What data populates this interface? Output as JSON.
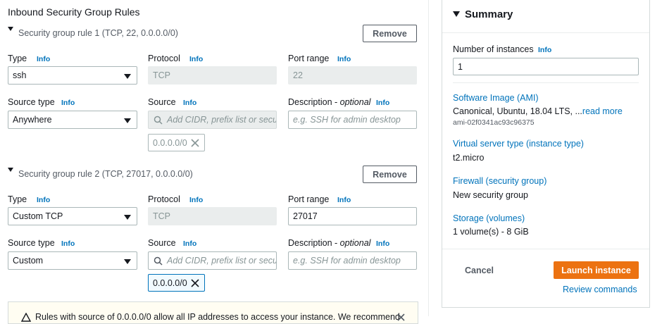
{
  "section_title": "Inbound Security Group Rules",
  "info_label": "Info",
  "rules": [
    {
      "header": "Security group rule 1 (TCP, 22, 0.0.0.0/0)",
      "remove_label": "Remove",
      "type_label": "Type",
      "type_value": "ssh",
      "protocol_label": "Protocol",
      "protocol_value": "TCP",
      "port_label": "Port range",
      "port_value": "22",
      "source_type_label": "Source type",
      "source_type_value": "Anywhere",
      "source_label": "Source",
      "source_placeholder": "Add CIDR, prefix list or security",
      "source_token": "0.0.0.0/0",
      "desc_label": "Description - ",
      "desc_optional": "optional",
      "desc_placeholder": "e.g. SSH for admin desktop"
    },
    {
      "header": "Security group rule 2 (TCP, 27017, 0.0.0.0/0)",
      "remove_label": "Remove",
      "type_label": "Type",
      "type_value": "Custom TCP",
      "protocol_label": "Protocol",
      "protocol_value": "TCP",
      "port_label": "Port range",
      "port_value": "27017",
      "source_type_label": "Source type",
      "source_type_value": "Custom",
      "source_label": "Source",
      "source_placeholder": "Add CIDR, prefix list or security",
      "source_token": "0.0.0.0/0",
      "desc_label": "Description - ",
      "desc_optional": "optional",
      "desc_placeholder": "e.g. SSH for admin desktop"
    }
  ],
  "warning_text": "Rules with source of 0.0.0.0/0 allow all IP addresses to access your instance. We recommend",
  "summary": {
    "title": "Summary",
    "instances_label": "Number of instances",
    "instances_value": "1",
    "ami_link": "Software Image (AMI)",
    "ami_value": "Canonical, Ubuntu, 18.04 LTS, ...",
    "read_more": "read more",
    "ami_id": "ami-02f0341ac93c96375",
    "instance_type_link": "Virtual server type (instance type)",
    "instance_type_value": "t2.micro",
    "firewall_link": "Firewall (security group)",
    "firewall_value": "New security group",
    "storage_link": "Storage (volumes)",
    "storage_value": "1 volume(s) - 8 GiB",
    "cancel_label": "Cancel",
    "launch_label": "Launch instance",
    "review_label": "Review commands"
  },
  "colors": {
    "link": "#0073bb",
    "primary": "#ec7211",
    "warning_bg": "#fffdf2"
  }
}
